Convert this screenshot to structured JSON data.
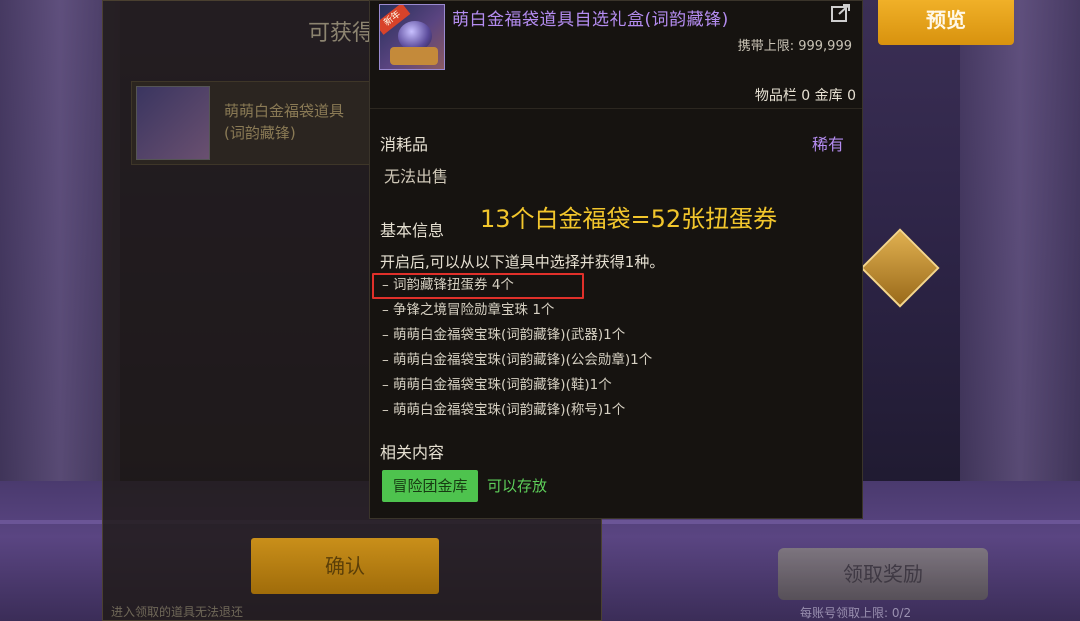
{
  "dialog": {
    "title": "可获得奖",
    "item_name": "萌萌白金福袋道具",
    "item_sub": "(词韵藏锋)",
    "confirm_label": "确认",
    "footnote": "进入领取的道具无法退还"
  },
  "right_panel": {
    "preview_label": "预览",
    "claim_label": "领取奖励",
    "claim_note": "每账号领取上限: 0/2"
  },
  "tooltip": {
    "title": "萌白金福袋道具自选礼盒(词韵藏锋)",
    "carry_limit": "携带上限: 999,999",
    "storage": "物品栏 0 金库 0",
    "item_type": "消耗品",
    "rarity": "稀有",
    "trade_status": "无法出售",
    "basic_info_heading": "基本信息",
    "annotation": "13个白金福袋=52张扭蛋券",
    "description": "开启后,可以从以下道具中选择并获得1种。",
    "options": [
      "– 词韵藏锋扭蛋券 4个",
      "– 争锋之境冒险勋章宝珠 1个",
      "– 萌萌白金福袋宝珠(词韵藏锋)(武器)1个",
      "– 萌萌白金福袋宝珠(词韵藏锋)(公会勋章)1个",
      "– 萌萌白金福袋宝珠(词韵藏锋)(鞋)1个",
      "– 萌萌白金福袋宝珠(词韵藏锋)(称号)1个"
    ],
    "related_heading": "相关内容",
    "tag_label": "冒险团金库",
    "tag_note": "可以存放",
    "icon_tag": "新年"
  },
  "colors": {
    "rarity_purple": "#b48cf0",
    "annotation_yellow": "#f2c62c",
    "highlight_red": "#e0302a",
    "tag_green": "#4ec34e"
  },
  "icons": [
    "external-link-icon",
    "item-icon",
    "diamond-badge-icon"
  ]
}
